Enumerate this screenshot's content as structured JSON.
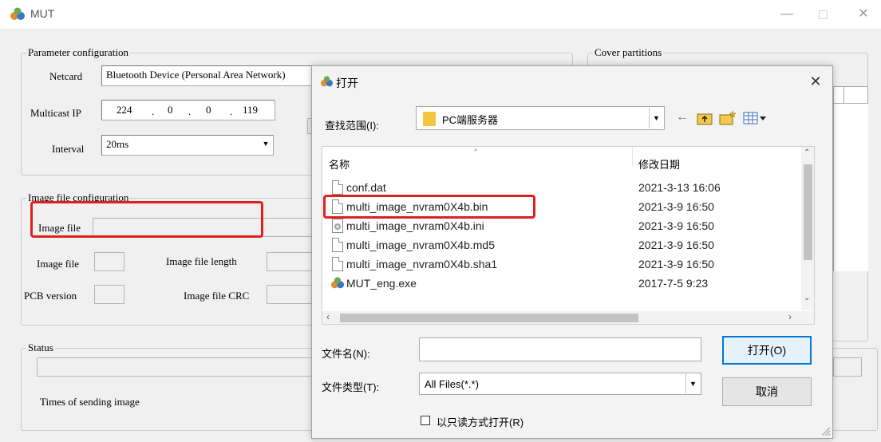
{
  "window": {
    "title": "MUT",
    "minimize": "—",
    "close": "✕"
  },
  "param": {
    "legend": "Parameter configuration",
    "netcard_label": "Netcard",
    "netcard_value": "Bluetooth Device (Personal Area Network)",
    "multicast_label": "Multicast IP",
    "ip": [
      "224",
      "0",
      "0",
      "119"
    ],
    "ip_sep": ".",
    "interval_label": "Interval",
    "interval_value": "20ms"
  },
  "cover": {
    "legend": "Cover partitions"
  },
  "image": {
    "legend": "Image file configuration",
    "image_file_label": "Image file",
    "image_file_label2": "Image file",
    "length_label": "Image file length",
    "pcb_label": "PCB version",
    "crc_label": "Image file CRC"
  },
  "status": {
    "legend": "Status",
    "times_label": "Times of sending image"
  },
  "dialog": {
    "title": "打开",
    "lookin_label": "查找范围(I):",
    "lookin_value": "PC端服务器",
    "col_name": "名称",
    "col_date": "修改日期",
    "files": [
      {
        "name": "conf.dat",
        "date": "2021-3-13 16:06",
        "icon": "document-icon"
      },
      {
        "name": "multi_image_nvram0X4b.bin",
        "date": "2021-3-9 16:50",
        "icon": "document-icon"
      },
      {
        "name": "multi_image_nvram0X4b.ini",
        "date": "2021-3-9 16:50",
        "icon": "settings-file-icon"
      },
      {
        "name": "multi_image_nvram0X4b.md5",
        "date": "2021-3-9 16:50",
        "icon": "document-icon"
      },
      {
        "name": "multi_image_nvram0X4b.sha1",
        "date": "2021-3-9 16:50",
        "icon": "document-icon"
      },
      {
        "name": "MUT_eng.exe",
        "date": "2017-7-5 9:23",
        "icon": "app-icon"
      }
    ],
    "filename_label": "文件名(N):",
    "filename_value": "",
    "filetype_label": "文件类型(T):",
    "filetype_value": "All Files(*.*)",
    "readonly_label": "以只读方式打开(R)",
    "open_button": "打开(O)",
    "cancel_button": "取消",
    "close": "✕"
  },
  "colors": {
    "highlight": "#e02020",
    "folder": "#f5c542",
    "default_button_border": "#0078d7"
  }
}
